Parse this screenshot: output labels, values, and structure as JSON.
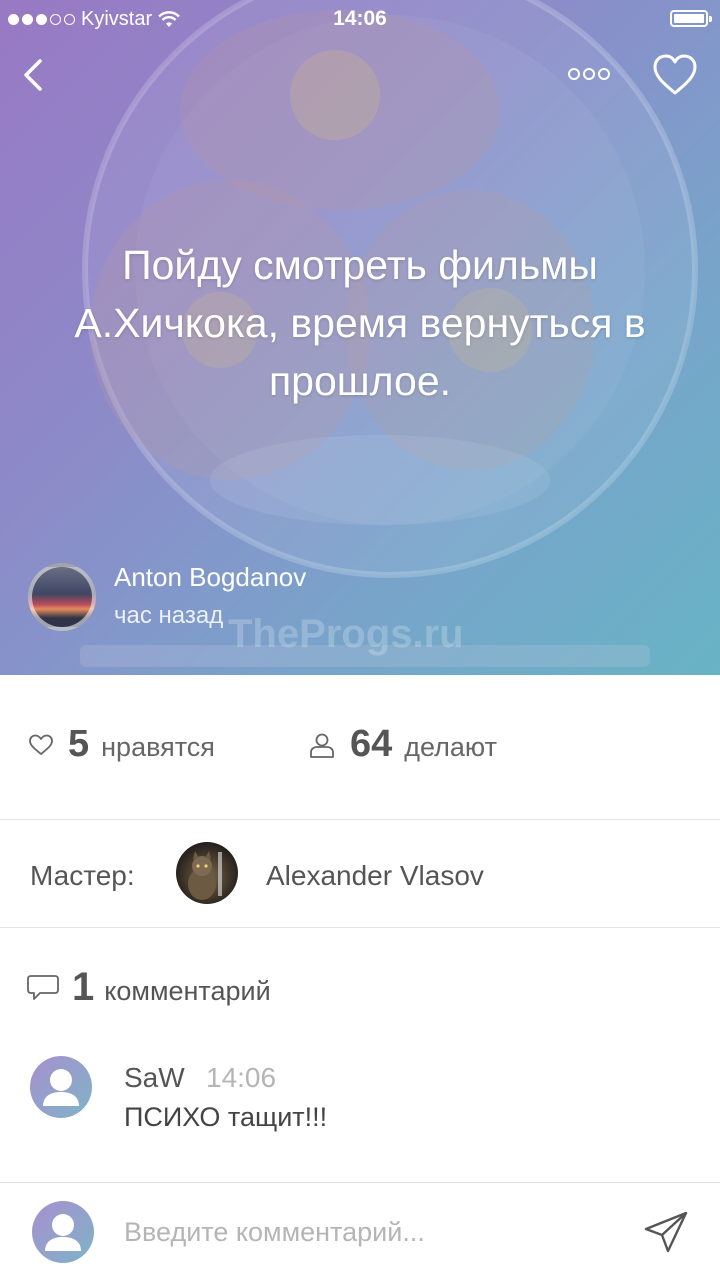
{
  "status_bar": {
    "carrier": "Kyivstar",
    "time": "14:06"
  },
  "post": {
    "title": "Пойду смотреть фильмы А.Хичкока, время вернуться в прошлое.",
    "author_name": "Anton Bogdanov",
    "posted_ago": "час назад"
  },
  "watermark": "TheProgs.ru",
  "stats": {
    "likes_count": "5",
    "likes_label": "нравятся",
    "doing_count": "64",
    "doing_label": "делают"
  },
  "master": {
    "label": "Мастер:",
    "name": "Alexander Vlasov"
  },
  "comments": {
    "count": "1",
    "label": "комментарий",
    "items": [
      {
        "author": "SaW",
        "time": "14:06",
        "text": "ПСИХО тащит!!!"
      }
    ]
  },
  "input": {
    "placeholder": "Введите комментарий..."
  },
  "colors": {
    "hero_gradient_start": "#9a7fc1",
    "hero_gradient_end": "#6fb3c3",
    "text_primary": "#555555",
    "text_muted": "#b5b5b5"
  }
}
